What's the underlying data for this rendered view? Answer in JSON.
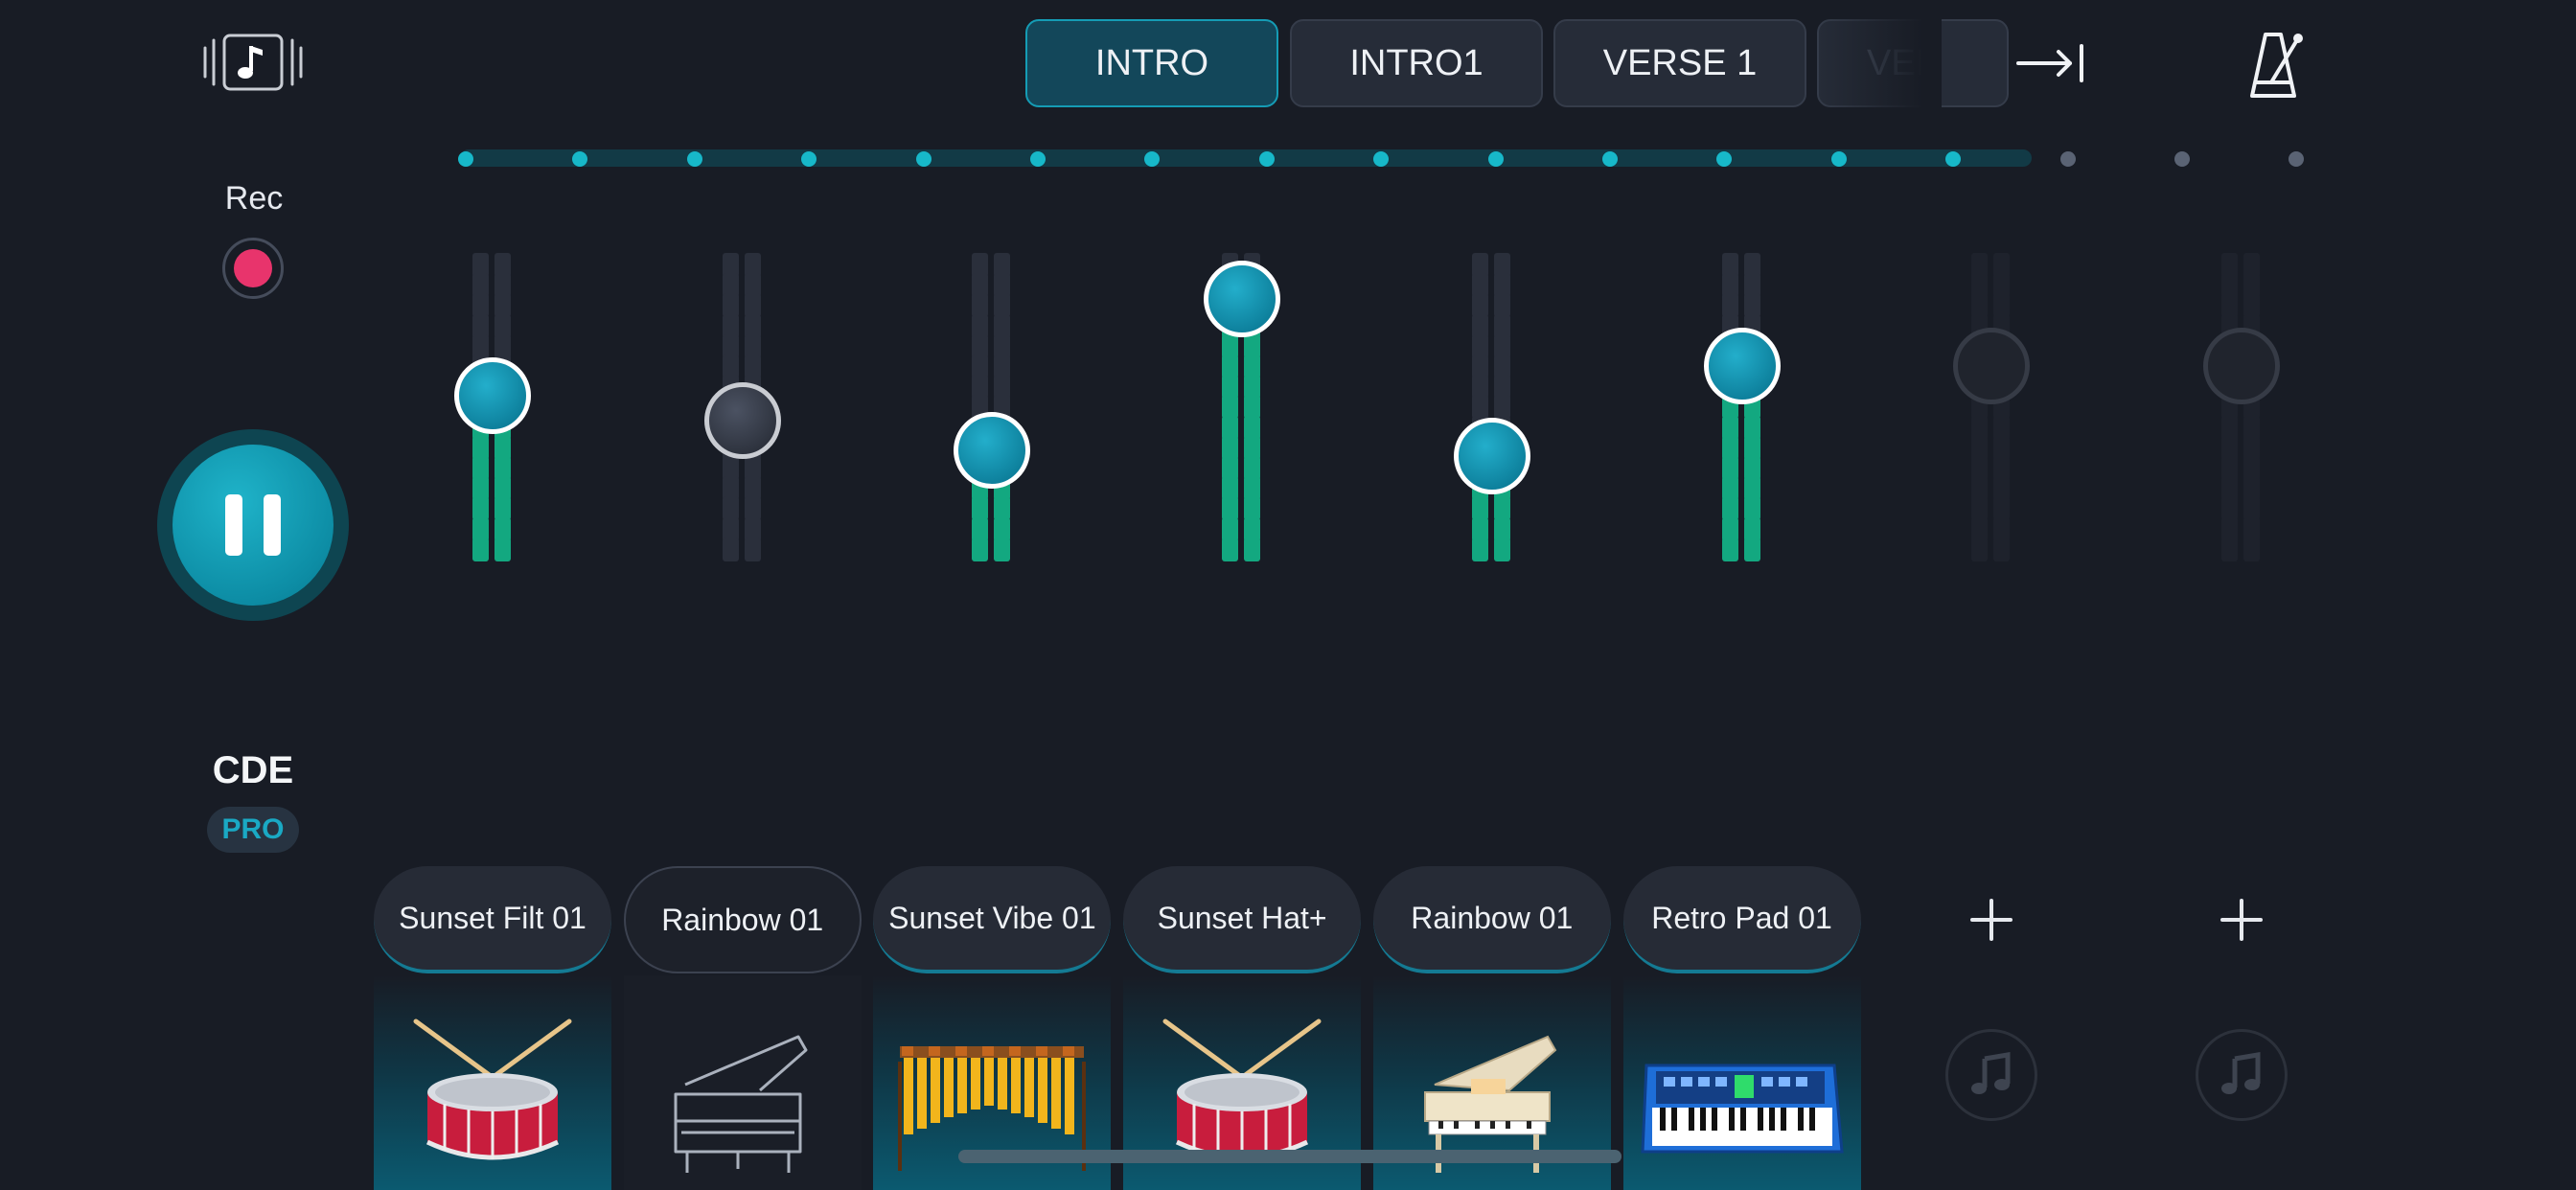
{
  "header": {
    "tabs": [
      {
        "label": "INTRO",
        "active": true
      },
      {
        "label": "INTRO1",
        "active": false
      },
      {
        "label": "VERSE 1",
        "active": false
      },
      {
        "label": "VER",
        "active": false
      }
    ]
  },
  "sidebar": {
    "rec_label": "Rec",
    "key_label": "CDE",
    "pro_badge": "PRO"
  },
  "progress": {
    "filled_ticks": 14,
    "total_ticks": 17
  },
  "channels": [
    {
      "name": "Sunset Filt 01",
      "icon": "snare-drum-icon",
      "volume": 0.58,
      "active": true,
      "meter_lit": 8
    },
    {
      "name": "Rainbow 01",
      "icon": "grand-piano-icon",
      "volume": 0.48,
      "active": false,
      "meter_lit": 0
    },
    {
      "name": "Sunset Vibe 01",
      "icon": "marimba-icon",
      "volume": 0.36,
      "active": true,
      "meter_lit": 5
    },
    {
      "name": "Sunset Hat+",
      "icon": "snare-drum-icon",
      "volume": 0.97,
      "active": true,
      "meter_lit": 14
    },
    {
      "name": "Rainbow 01",
      "icon": "grand-piano-icon",
      "volume": 0.34,
      "active": true,
      "meter_lit": 4
    },
    {
      "name": "Retro Pad 01",
      "icon": "synthesizer-icon",
      "volume": 0.7,
      "active": true,
      "meter_lit": 10
    },
    {
      "empty": true
    },
    {
      "empty": true
    }
  ],
  "colors": {
    "accent": "#159cb5",
    "meter_on": "#13a880",
    "meter_off": "#2a2f3b",
    "record": "#e8346c"
  }
}
